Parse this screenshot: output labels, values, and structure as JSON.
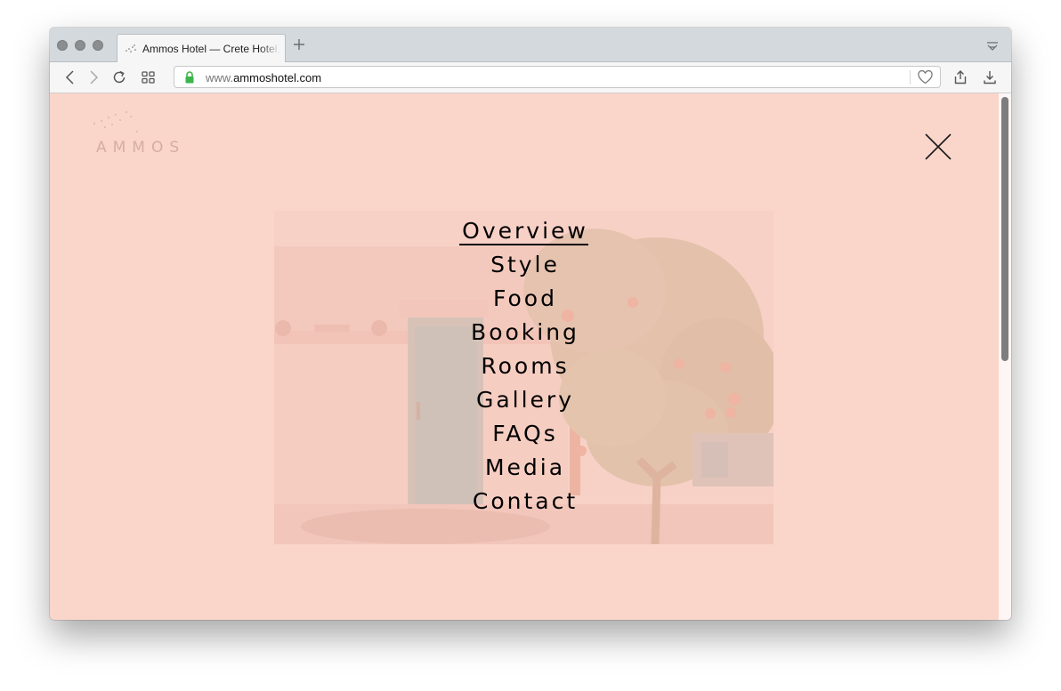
{
  "browser": {
    "tab": {
      "title": "Ammos Hotel — Crete Hotel,"
    },
    "url": {
      "prefix": "www.",
      "domain": "ammoshotel.com"
    },
    "icons": {
      "back": "back-arrow-icon",
      "forward": "forward-arrow-icon",
      "reload": "reload-icon",
      "tabs_overview": "grid-icon",
      "lock": "lock-icon",
      "bookmark": "heart-icon",
      "share": "share-icon",
      "download": "download-icon",
      "new_tab": "plus-icon",
      "tab_list": "tab-list-icon"
    },
    "colors": {
      "lock": "#3cb64b"
    }
  },
  "site": {
    "logo_text": "AMMOS",
    "background": "#fad5ca",
    "close_icon": "close-icon",
    "nav": {
      "active": "Overview",
      "items": [
        {
          "label": "Overview"
        },
        {
          "label": "Style"
        },
        {
          "label": "Food"
        },
        {
          "label": "Booking"
        },
        {
          "label": "Rooms"
        },
        {
          "label": "Gallery"
        },
        {
          "label": "FAQs"
        },
        {
          "label": "Media"
        },
        {
          "label": "Contact"
        }
      ]
    }
  }
}
